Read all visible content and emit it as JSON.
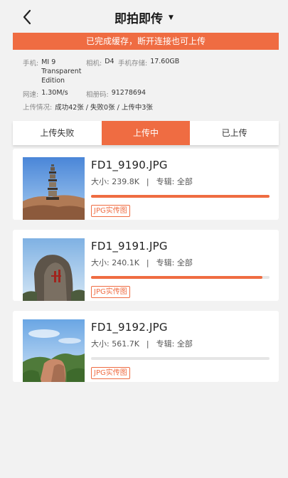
{
  "header": {
    "title": "即拍即传",
    "dropdown_caret": "▼"
  },
  "banner": "已完成缓存，断开连接也可上传",
  "info": {
    "phone_label": "手机:",
    "phone_value": "MI 9 Transparent Edition",
    "camera_label": "相机:",
    "camera_value": "D4",
    "storage_label": "手机存储:",
    "storage_value": "17.60GB",
    "speed_label": "网速:",
    "speed_value": "1.30M/s",
    "album_code_label": "相册码:",
    "album_code_value": "91278694",
    "upload_status_label": "上传情况:",
    "upload_status_value": "成功42张 / 失败0张 / 上传中3张"
  },
  "tabs": [
    {
      "label": "上传失败",
      "active": false
    },
    {
      "label": "上传中",
      "active": true
    },
    {
      "label": "已上传",
      "active": false
    }
  ],
  "files": [
    {
      "name": "FD1_9190.JPG",
      "size": "大小: 239.8K",
      "separator": "|",
      "album": "专辑: 全部",
      "progress": 1.0,
      "tag": "JPG实传图",
      "thumb_icon": "pagoda-photo"
    },
    {
      "name": "FD1_9191.JPG",
      "size": "大小: 240.1K",
      "separator": "|",
      "album": "专辑: 全部",
      "progress": 0.96,
      "tag": "JPG实传图",
      "thumb_icon": "rock-inscription-photo"
    },
    {
      "name": "FD1_9192.JPG",
      "size": "大小: 561.7K",
      "separator": "|",
      "album": "专辑: 全部",
      "progress": 0.0,
      "tag": "JPG实传图",
      "thumb_icon": "mountain-photo"
    }
  ],
  "colors": {
    "accent": "#ef6c42",
    "background": "#f2f2f2"
  }
}
